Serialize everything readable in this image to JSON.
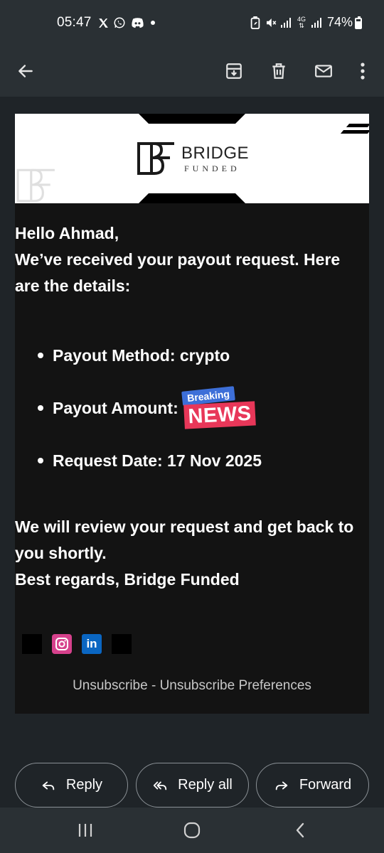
{
  "status_bar": {
    "time": "05:47",
    "battery": "74%",
    "network_label": "4G",
    "notification_icons": [
      "x-icon",
      "whatsapp-icon",
      "discord-icon",
      "dot-icon"
    ],
    "system_icons": [
      "battery-saver-icon",
      "mute-icon",
      "signal-icon",
      "4g-icon",
      "signal-icon-2"
    ]
  },
  "app_bar": {
    "icons": [
      "back-arrow-icon",
      "archive-icon",
      "delete-icon",
      "mark-unread-icon",
      "more-options-icon"
    ]
  },
  "email": {
    "brand": {
      "title": "BRIDGE",
      "subtitle": "FUNDED"
    },
    "greeting": "Hello Ahmad,",
    "intro": "We’ve received your payout request. Here are the details:",
    "details": [
      {
        "label": "Payout Method: crypto"
      },
      {
        "label": "Payout Amount:"
      },
      {
        "label": "Request Date: 17 Nov 2025"
      }
    ],
    "news_badge": {
      "top": "Breaking",
      "main": "NEWS"
    },
    "closing": "We will review your request and get back to you shortly.",
    "regards": "Best regards, Bridge Funded",
    "social_icons": [
      "x-social-icon",
      "instagram-icon",
      "linkedin-icon",
      "tiktok-icon"
    ],
    "unsubscribe": "Unsubscribe",
    "separator": " - ",
    "unsubscribe_preferences": "Unsubscribe Preferences"
  },
  "actions": {
    "reply": "Reply",
    "reply_all": "Reply all",
    "forward": "Forward"
  },
  "nav_bar": {
    "icons": [
      "recent-apps-icon",
      "home-icon",
      "back-icon"
    ]
  },
  "colors": {
    "status_bar_bg": "#2a3034",
    "content_bg": "#1f2428",
    "card_bg": "#131313",
    "badge_blue": "#3d6fd8",
    "badge_red": "#e83759"
  }
}
